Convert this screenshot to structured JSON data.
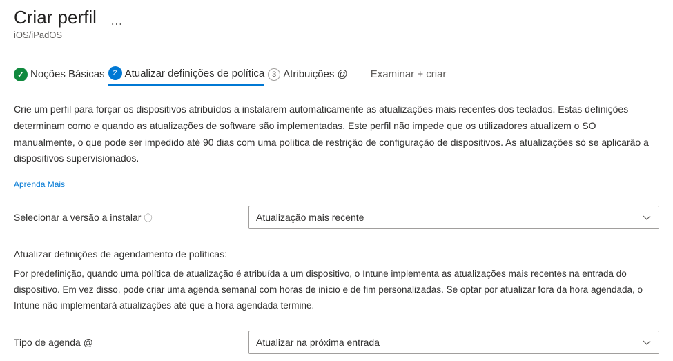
{
  "header": {
    "title": "Criar perfil",
    "subtitle": "iOS/iPadOS",
    "more_icon": "…"
  },
  "stepper": {
    "step1": {
      "label": "Noções Básicas"
    },
    "step2": {
      "label": "Atualizar definições de política",
      "num": "2"
    },
    "step3": {
      "label": "Atribuições @",
      "num": "3"
    },
    "step4": {
      "label": "Examinar + criar"
    }
  },
  "description": "Crie um perfil para forçar os dispositivos atribuídos a instalarem automaticamente as atualizações mais recentes dos teclados. Estas definições determinam como e quando as atualizações de software são implementadas. Este perfil não impede que os utilizadores atualizem o SO manualmente, o que pode ser impedido até 90 dias com uma política de restrição de configuração de dispositivos. As atualizações só se aplicarão a dispositivos supervisionados.",
  "learn_more": "Aprenda Mais",
  "fields": {
    "version": {
      "label": "Selecionar a versão a instalar",
      "value": "Atualização mais recente"
    },
    "schedule_heading": "Atualizar definições de agendamento de políticas:",
    "schedule_text": "Por predefinição, quando uma política de atualização é atribuída a um dispositivo, o Intune implementa as atualizações mais recentes na entrada do dispositivo. Em vez disso, pode criar uma agenda semanal com horas de início e de fim personalizadas. Se optar por atualizar fora da hora agendada, o Intune não implementará atualizações até que a hora agendada termine.",
    "schedule_type": {
      "label": "Tipo de agenda @",
      "value": "Atualizar na próxima entrada"
    }
  },
  "glyphs": {
    "check": "✓",
    "info": "ⓘ"
  }
}
